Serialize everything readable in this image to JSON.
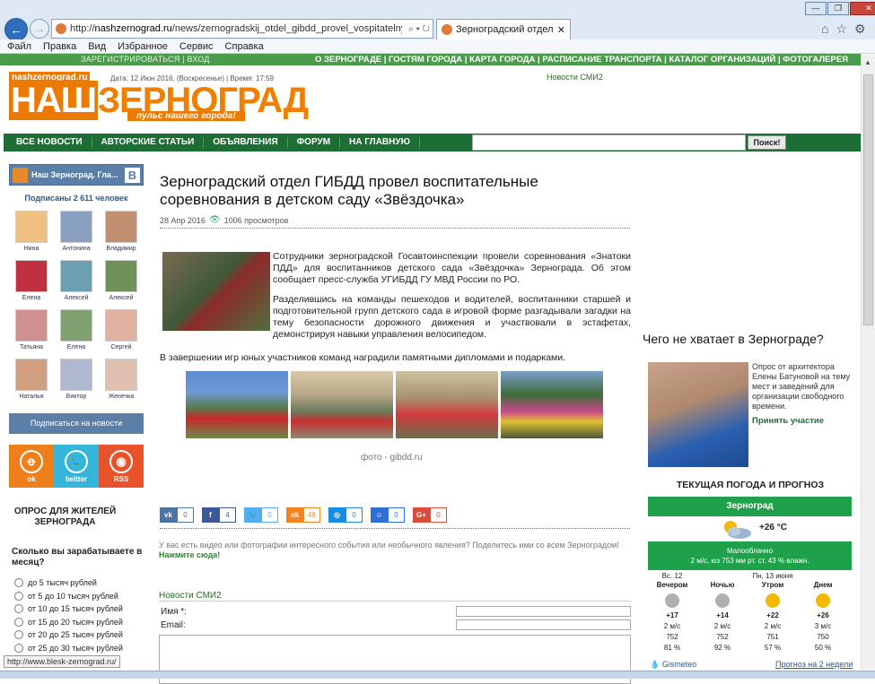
{
  "browser": {
    "url_prefix": "http://",
    "url_domain": "nashzernograd.ru",
    "url_path": "/news/zernogradskij_otdel_gibdd_provel_vospitatelnye_sorevnovani",
    "tab_title": "Зерноградский отдел ГИБ...",
    "search_ctl": "⌕ ▾ ↻",
    "tab_close": "✕",
    "win_min": "—",
    "win_max": "❐",
    "win_close": "✕",
    "tools": [
      "⌂",
      "☆",
      "⚙"
    ],
    "menu": [
      "Файл",
      "Правка",
      "Вид",
      "Избранное",
      "Сервис",
      "Справка"
    ],
    "status_url": "http://www.blesk-zernograd.ru/"
  },
  "site": {
    "top_reg": "ЗАРЕГИСТРИРОВАТЬСЯ | ВХОД",
    "top_links": "О ЗЕРНОГРАДЕ | ГОСТЯМ ГОРОДА | КАРТА ГОРОДА | РАСПИСАНИЕ ТРАНСПОРТА | КАТАЛОГ ОРГАНИЗАЦИЙ | ФОТОГАЛЕРЕЯ",
    "logo_domain": "nashzernograd.ru",
    "logo_prefix": "НАШ",
    "logo_main": "ЗЕРНОГРАД",
    "logo_tag": "пульс нашего города!",
    "datetime": "Дата: 12 Июн 2016, (Воскресенье) | Время: 17:59",
    "smi_top": "Новости СМИ2",
    "nav": [
      "ВСЕ НОВОСТИ",
      "АВТОРСКИЕ СТАТЬИ",
      "ОБЪЯВЛЕНИЯ",
      "ФОРУМ",
      "НА ГЛАВНУЮ"
    ],
    "search_button": "Поиск!"
  },
  "vk": {
    "name": "Наш Зерноград. Гла...",
    "badge": "B",
    "subscribed": "Подписаны 2 611 человек",
    "members": [
      "Нина",
      "Антонина",
      "Владимир",
      "Елена",
      "Алексей",
      "Алексей",
      "Татьяна",
      "Елена",
      "Сергей",
      "Наталья",
      "Виктор",
      "Женечка"
    ],
    "subscribe_label": "Подписаться на новости"
  },
  "social": [
    {
      "label": "ok",
      "glyph": "ꝋ",
      "color": "#ef7f1a"
    },
    {
      "label": "twitter",
      "glyph": "🐦",
      "color": "#33b6d9"
    },
    {
      "label": "RSS",
      "glyph": "◉",
      "color": "#e8532c"
    }
  ],
  "poll": {
    "title": "ОПРОС ДЛЯ ЖИТЕЛЕЙ ЗЕРНОГРАДА",
    "question": "Сколько вы зарабатываете в месяц?",
    "options": [
      "до 5 тысяч рублей",
      "от 5 до 10 тысяч рублей",
      "от 10 до 15 тысяч рублей",
      "от 15 до 20 тысяч рублей",
      "от 20 до 25 тысяч рублей",
      "от 25 до 30 тысяч рублей"
    ]
  },
  "article": {
    "title": "Зерноградский отдел ГИБДД провел воспитательные соревнования в детском саду «Звёздочка»",
    "date": "28 Апр 2016",
    "views": "1006 просмотров",
    "p1": "Сотрудники зерноградской Госавтоинспекции провели соревнования «Знатоки ПДД» для воспитанников детского сада «Звёздочка» Зернограда. Об этом сообщает пресс-служба УГИБДД ГУ МВД России по РО.",
    "p2": "Разделившись на команды пешеходов и водителей, воспитанники старшей и подготовительной групп детского сада в игровой форме разгадывали загадки на тему безопасности дорожного движения и участвовали в эстафетах, демонстрируя навыки управления велосипедом.",
    "p3": "В завершении игр юных участников команд наградили памятными дипломами и подарками.",
    "photo_caption": "фото - gibdd.ru"
  },
  "share": [
    {
      "icon": "vk",
      "count": "0",
      "color": "#4c75a3"
    },
    {
      "icon": "f",
      "count": "4",
      "color": "#3b5998"
    },
    {
      "icon": "🐦",
      "count": "0",
      "color": "#55acee"
    },
    {
      "icon": "ok",
      "count": "46",
      "color": "#f58220"
    },
    {
      "icon": "◎",
      "count": "0",
      "color": "#168de2"
    },
    {
      "icon": "☺",
      "count": "0",
      "color": "#2d6fd6"
    },
    {
      "icon": "G+",
      "count": "0",
      "color": "#dd4b39"
    }
  ],
  "cta": {
    "text": "У вас есть видео или фотографии интересного события или необычного явления? Поделитесь ими со всем Зерноградом!",
    "link": "Нажмите сюда!"
  },
  "comments": {
    "smi2": "Новости СМИ2",
    "name_label": "Имя *:",
    "email_label": "Email:"
  },
  "right": {
    "heading": "Чего не хватает в Зернограде?",
    "text": "Опрос от архитектора Елены Батуновой на тему мест и заведений для организации свободного времени.",
    "link": "Принять участие"
  },
  "weather": {
    "heading": "ТЕКУЩАЯ ПОГОДА И ПРОГНОЗ",
    "city": "Зерноград",
    "temp_now": "+26 °C",
    "desc": "Малооблачно",
    "details": "2 м/с, юз   753 мм рт. ст.   43 % влажн.",
    "forecast": [
      {
        "day": "Вс. 12",
        "period": "Вечером",
        "temp": "+17",
        "wind": "2 м/с",
        "pressure": "752",
        "humidity": "81 %",
        "icon": "moon",
        "color": "#b0b0b0"
      },
      {
        "day": "",
        "period": "Ночью",
        "temp": "+14",
        "wind": "2 м/с",
        "pressure": "752",
        "humidity": "92 %",
        "icon": "moon",
        "color": "#b0b0b0"
      },
      {
        "day": "Пн, 13 июня",
        "period": "Утром",
        "temp": "+22",
        "wind": "2 м/с",
        "pressure": "751",
        "humidity": "57 %",
        "icon": "sun",
        "color": "#f5b800"
      },
      {
        "day": "",
        "period": "Днем",
        "temp": "+26",
        "wind": "3 м/с",
        "pressure": "750",
        "humidity": "50 %",
        "icon": "sun",
        "color": "#f5b800"
      }
    ],
    "gismeteo": "Gismeteo",
    "two_weeks": "Прогноз на 2 недели"
  }
}
